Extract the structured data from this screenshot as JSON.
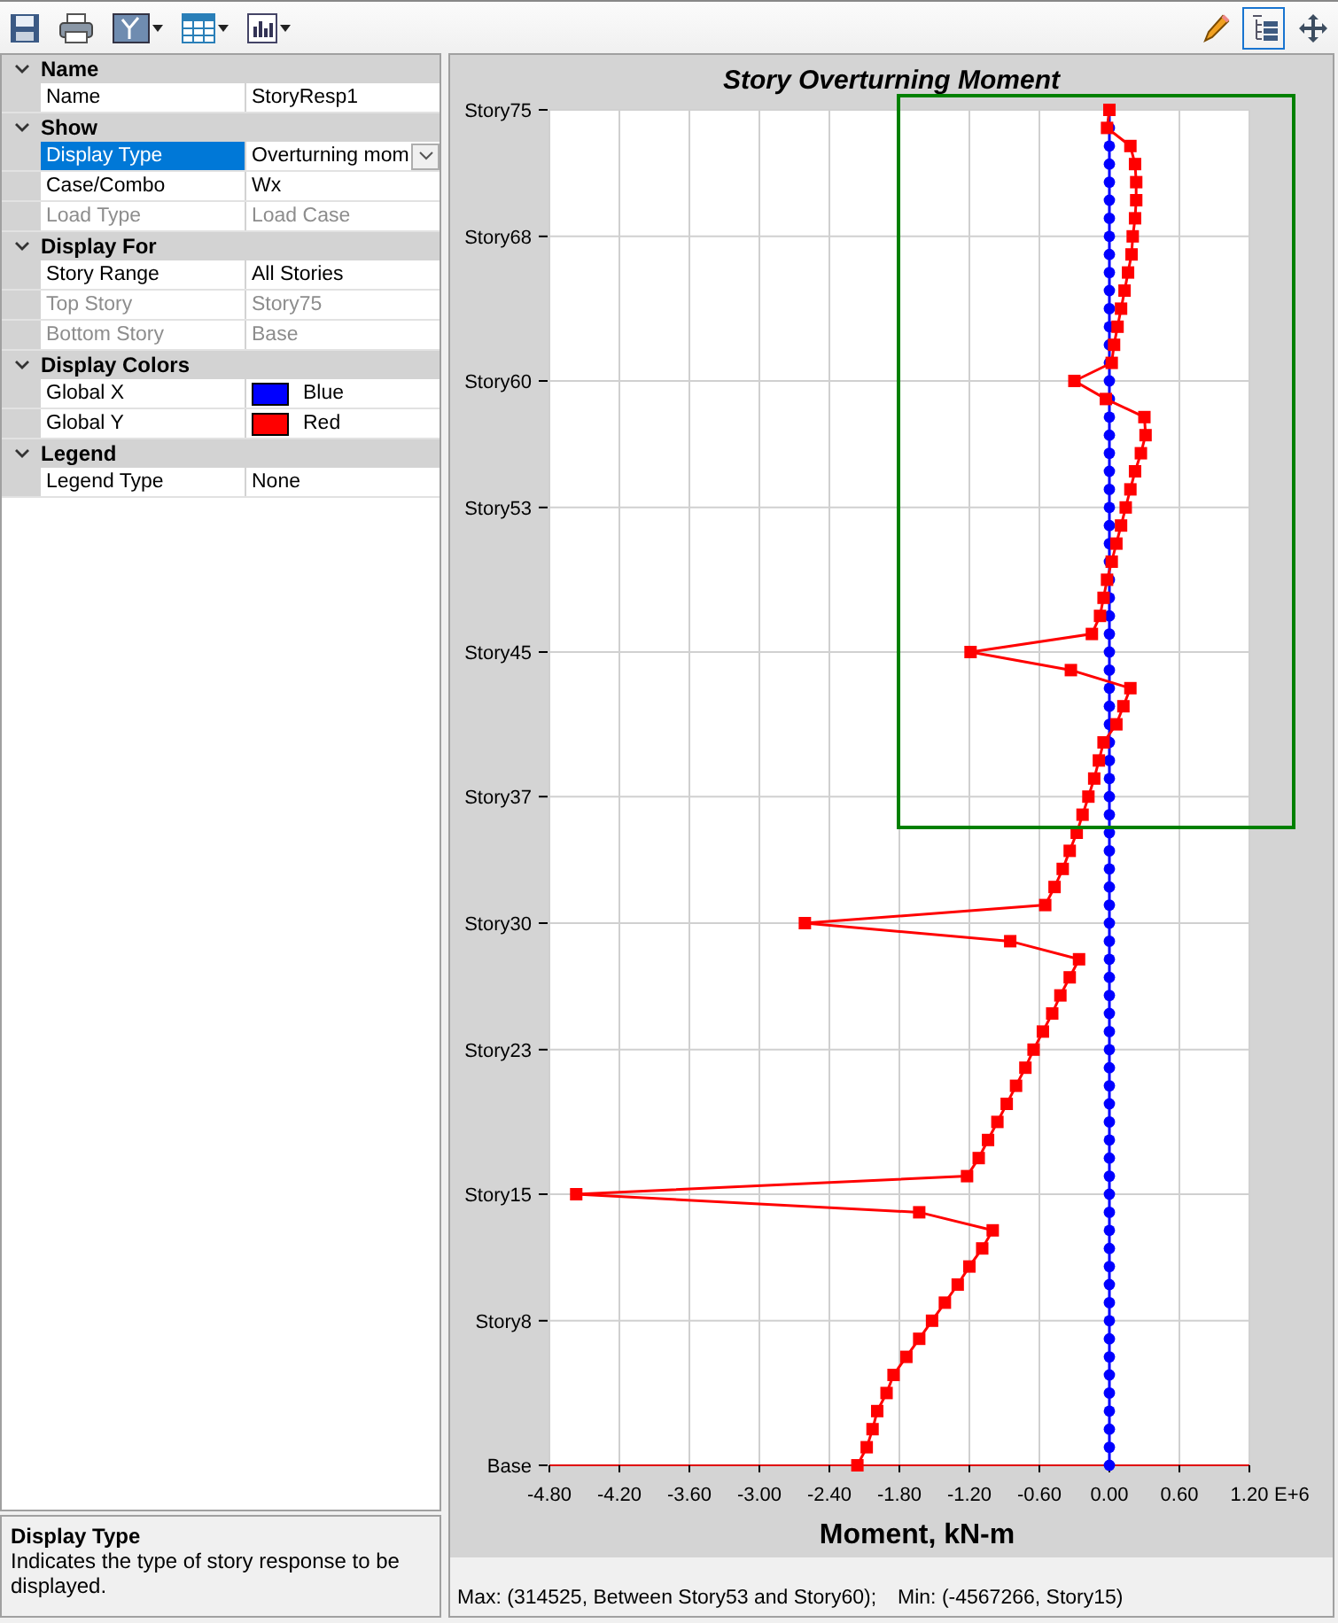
{
  "toolbar": {
    "left": [
      {
        "kind": "save",
        "dropdown": false
      },
      {
        "kind": "print",
        "dropdown": false
      },
      {
        "kind": "chart",
        "dropdown": true
      },
      {
        "kind": "table",
        "dropdown": true
      },
      {
        "kind": "bars",
        "dropdown": true
      }
    ],
    "right": [
      {
        "kind": "pencil",
        "selected": false
      },
      {
        "kind": "tree",
        "selected": true
      },
      {
        "kind": "move",
        "selected": false
      }
    ]
  },
  "properties": [
    {
      "title": "Name",
      "expanded": true,
      "rows": [
        {
          "label": "Name",
          "value": "StoryResp1",
          "kind": "text",
          "disabled": false,
          "selected": false
        }
      ]
    },
    {
      "title": "Show",
      "expanded": true,
      "rows": [
        {
          "label": "Display Type",
          "value": "Overturning mom",
          "kind": "dropdown",
          "disabled": false,
          "selected": true
        },
        {
          "label": "Case/Combo",
          "value": "Wx",
          "kind": "text",
          "disabled": false,
          "selected": false
        },
        {
          "label": "Load Type",
          "value": "Load Case",
          "kind": "text",
          "disabled": true,
          "selected": false
        }
      ]
    },
    {
      "title": "Display For",
      "expanded": true,
      "rows": [
        {
          "label": "Story Range",
          "value": "All Stories",
          "kind": "text",
          "disabled": false,
          "selected": false
        },
        {
          "label": "Top Story",
          "value": "Story75",
          "kind": "text",
          "disabled": true,
          "selected": false
        },
        {
          "label": "Bottom Story",
          "value": "Base",
          "kind": "text",
          "disabled": true,
          "selected": false
        }
      ]
    },
    {
      "title": "Display Colors",
      "expanded": true,
      "rows": [
        {
          "label": "Global X",
          "value": "Blue",
          "kind": "color",
          "color": "#0000ff",
          "disabled": false,
          "selected": false
        },
        {
          "label": "Global Y",
          "value": "Red",
          "kind": "color",
          "color": "#ff0000",
          "disabled": false,
          "selected": false
        }
      ]
    },
    {
      "title": "Legend",
      "expanded": true,
      "rows": [
        {
          "label": "Legend Type",
          "value": "None",
          "kind": "text",
          "disabled": false,
          "selected": false
        }
      ]
    }
  ],
  "description": {
    "title": "Display Type",
    "text": "Indicates the type of story response to be displayed."
  },
  "chart": {
    "chart_data": {
      "type": "line",
      "orientation": "horizontal",
      "title": "Story Overturning Moment",
      "xlabel": "Moment, kN-m",
      "xlim": [
        -4.8,
        1.2
      ],
      "grid": true,
      "categories": [
        "Story75",
        null,
        null,
        null,
        null,
        null,
        null,
        "Story68",
        null,
        null,
        null,
        null,
        null,
        null,
        null,
        "Story60",
        null,
        null,
        null,
        null,
        null,
        null,
        "Story53",
        null,
        null,
        null,
        null,
        null,
        null,
        null,
        "Story45",
        null,
        null,
        null,
        null,
        null,
        null,
        null,
        "Story37",
        null,
        null,
        null,
        null,
        null,
        null,
        "Story30",
        null,
        null,
        null,
        null,
        null,
        null,
        "Story23",
        null,
        null,
        null,
        null,
        null,
        null,
        null,
        "Story15",
        null,
        null,
        null,
        null,
        null,
        null,
        "Story8",
        null,
        null,
        null,
        null,
        null,
        null,
        null,
        "Base"
      ],
      "xticks": [
        {
          "value": -4.8,
          "label": "-4.80"
        },
        {
          "value": -4.2,
          "label": "-4.20"
        },
        {
          "value": -3.6,
          "label": "-3.60"
        },
        {
          "value": -3.0,
          "label": "-3.00"
        },
        {
          "value": -2.4,
          "label": "-2.40"
        },
        {
          "value": -1.8,
          "label": "-1.80"
        },
        {
          "value": -1.2,
          "label": "-1.20"
        },
        {
          "value": -0.6,
          "label": "-0.60"
        },
        {
          "value": 0,
          "label": "0.00"
        },
        {
          "value": 0.6,
          "label": "0.60"
        },
        {
          "value": 1.2,
          "label": "1.20"
        }
      ],
      "series": [
        {
          "color": "#0000ff",
          "marker": "circle",
          "values": [
            0,
            0,
            0,
            0,
            0,
            0,
            0,
            0,
            0,
            0,
            0,
            0,
            0,
            0,
            0,
            0,
            0,
            0,
            0,
            0,
            0,
            0,
            0,
            0,
            0,
            0,
            0,
            0,
            0,
            0,
            0,
            0,
            0,
            0,
            0,
            0,
            0,
            0,
            0,
            0,
            0,
            0,
            0,
            0,
            0,
            0,
            0,
            0,
            0,
            0,
            0,
            0,
            0,
            0,
            0,
            0,
            0,
            0,
            0,
            0,
            0,
            0,
            0,
            0,
            0,
            0,
            0,
            0,
            0,
            0,
            0,
            0,
            0,
            0,
            0,
            0
          ]
        },
        {
          "color": "#ff0000",
          "marker": "square",
          "values": [
            0.0,
            -0.02,
            0.18,
            0.22,
            0.23,
            0.23,
            0.22,
            0.2,
            0.19,
            0.16,
            0.13,
            0.1,
            0.07,
            0.04,
            0.02,
            -0.3,
            -0.03,
            0.3,
            0.31,
            0.27,
            0.22,
            0.18,
            0.14,
            0.1,
            0.06,
            0.02,
            -0.02,
            -0.05,
            -0.08,
            -0.15,
            -1.19,
            -0.33,
            0.18,
            0.12,
            0.06,
            -0.05,
            -0.09,
            -0.13,
            -0.18,
            -0.23,
            -0.28,
            -0.34,
            -0.4,
            -0.47,
            -0.55,
            -2.61,
            -0.85,
            -0.26,
            -0.34,
            -0.42,
            -0.49,
            -0.57,
            -0.65,
            -0.72,
            -0.8,
            -0.88,
            -0.96,
            -1.04,
            -1.12,
            -1.22,
            -4.57,
            -1.63,
            -1.0,
            -1.09,
            -1.2,
            -1.3,
            -1.41,
            -1.52,
            -1.63,
            -1.74,
            -1.85,
            -1.91,
            -1.99,
            -2.03,
            -2.08,
            -2.16
          ]
        }
      ]
    },
    "axis_multiplier": "E+6"
  },
  "status_bar": [
    "Max: (314525, Between Story53 and Story60);",
    "Min: (-4567266, Story15)"
  ]
}
